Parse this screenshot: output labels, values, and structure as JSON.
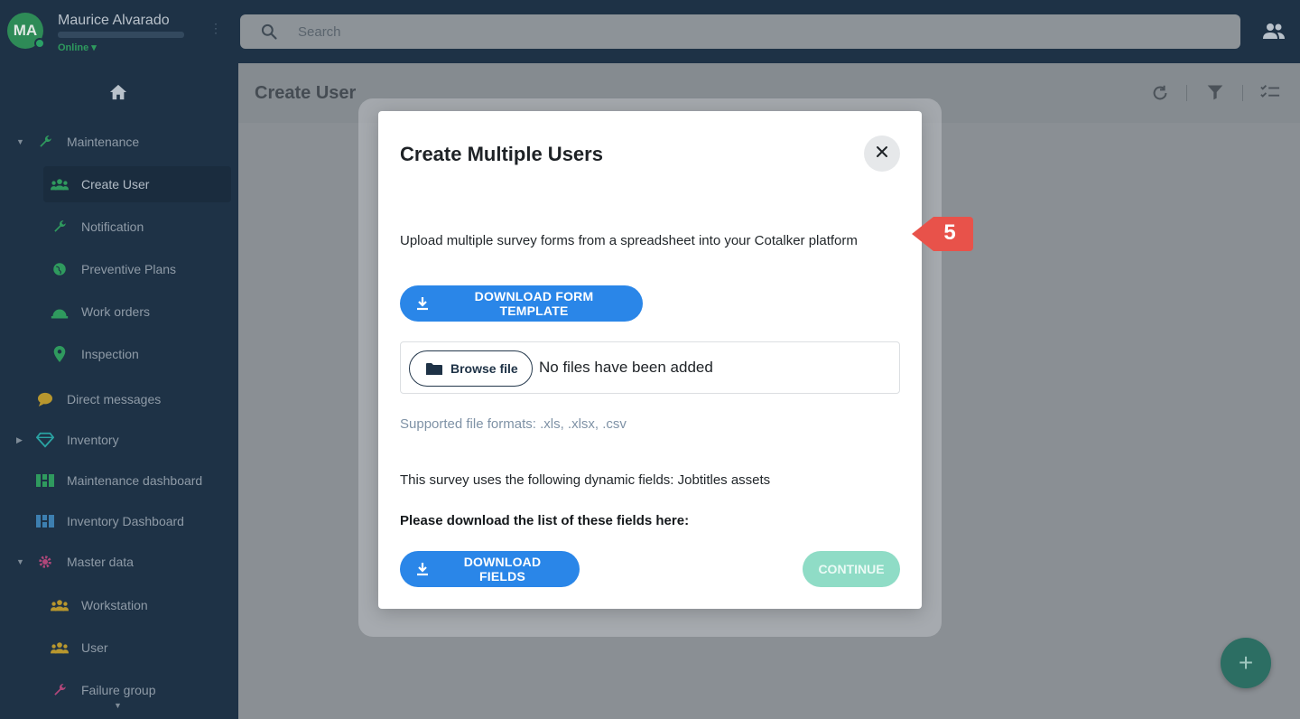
{
  "user": {
    "initials": "MA",
    "name": "Maurice Alvarado",
    "status": "Online ▾"
  },
  "search": {
    "placeholder": "Search"
  },
  "page": {
    "title": "Create User"
  },
  "sidebar": {
    "items": [
      {
        "label": "Maintenance",
        "icon": "wrench-icon",
        "icon_color": "#2f9a5e"
      },
      {
        "label": "Create User",
        "icon": "users-icon",
        "icon_color": "#2f9a5e"
      },
      {
        "label": "Notification",
        "icon": "wrench-icon",
        "icon_color": "#2f9a5e"
      },
      {
        "label": "Preventive Plans",
        "icon": "globe-icon",
        "icon_color": "#2f9a5e"
      },
      {
        "label": "Work orders",
        "icon": "hardhat-icon",
        "icon_color": "#2f9a5e"
      },
      {
        "label": "Inspection",
        "icon": "location-pin-icon",
        "icon_color": "#2f9a5e"
      },
      {
        "label": "Direct messages",
        "icon": "chat-bubble-icon",
        "icon_color": "#b8972e"
      },
      {
        "label": "Inventory",
        "icon": "diamond-icon",
        "icon_color": "#2aa3a3"
      },
      {
        "label": "Maintenance dashboard",
        "icon": "grid-icon",
        "icon_color": "#2f9a5e"
      },
      {
        "label": "Inventory Dashboard",
        "icon": "grid-icon",
        "icon_color": "#3d7fb0"
      },
      {
        "label": "Master data",
        "icon": "cog-icon",
        "icon_color": "#b0477a"
      },
      {
        "label": "Workstation",
        "icon": "users-icon",
        "icon_color": "#b8972e"
      },
      {
        "label": "User",
        "icon": "users-icon",
        "icon_color": "#b8972e"
      },
      {
        "label": "Failure group",
        "icon": "wrench-icon",
        "icon_color": "#b0477a"
      }
    ]
  },
  "modal": {
    "title": "Create Multiple Users",
    "description": "Upload multiple survey forms from a spreadsheet into your Cotalker platform",
    "download_template_label": "DOWNLOAD FORM TEMPLATE",
    "browse_label": "Browse file",
    "no_files_text": "No files have been added",
    "formats_text": "Supported file formats: .xls, .xlsx, .csv",
    "dynamic_fields_text": "This survey uses the following dynamic fields: Jobtitles assets",
    "download_list_text": "Please download the list of these fields here:",
    "download_fields_label": "DOWNLOAD FIELDS",
    "continue_label": "CONTINUE"
  },
  "step_badge": {
    "number": "5",
    "color": "#e8524a"
  },
  "colors": {
    "sidebar_bg": "#1e3246",
    "primary_blue": "#2a86e8",
    "continue_disabled": "#8fdcc6"
  }
}
